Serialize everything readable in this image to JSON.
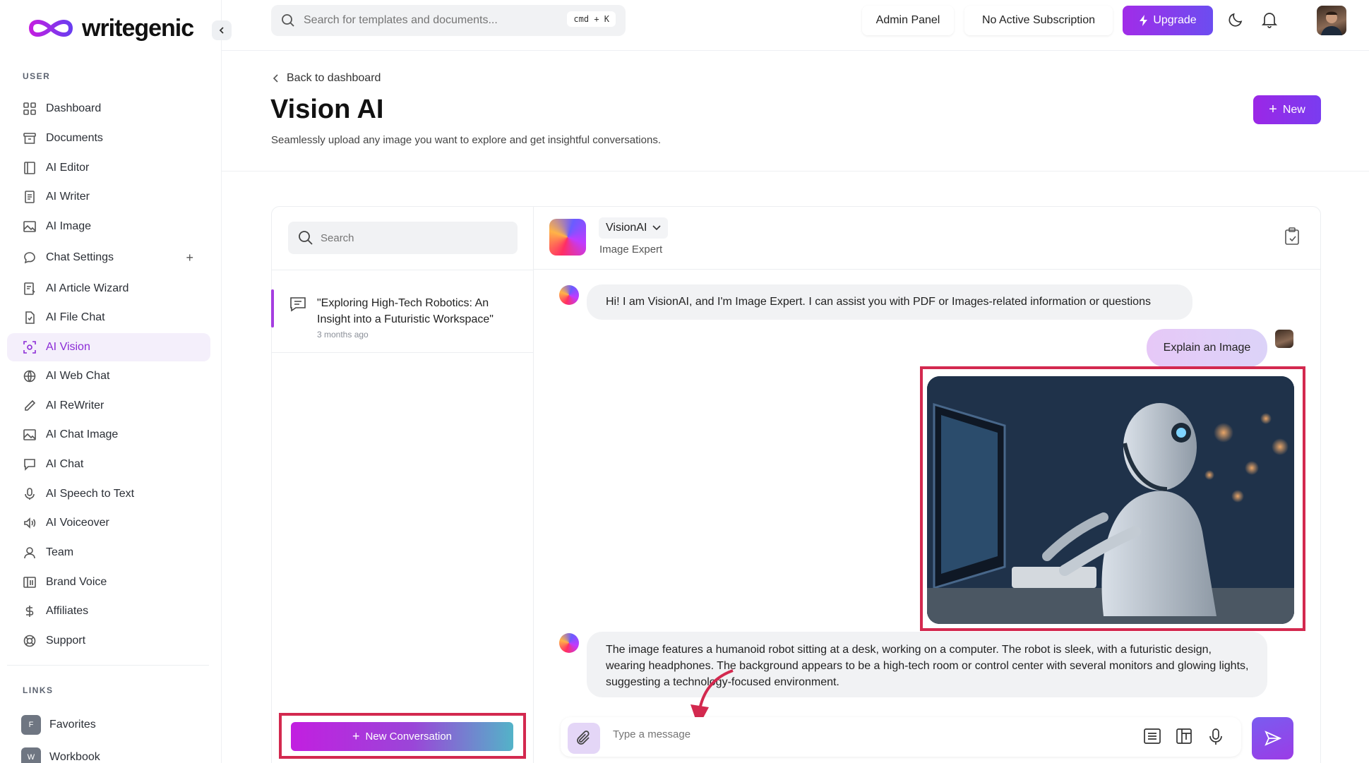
{
  "brand": {
    "name": "writegenic",
    "accent": "#8b2bd6"
  },
  "search": {
    "placeholder": "Search for templates and documents...",
    "shortcut": "cmd + K"
  },
  "topbar": {
    "admin_label": "Admin Panel",
    "subscription_label": "No Active Subscription",
    "upgrade_label": "Upgrade"
  },
  "sidebar": {
    "user_section": "USER",
    "items": [
      {
        "label": "Dashboard",
        "icon": "grid-icon"
      },
      {
        "label": "Documents",
        "icon": "archive-icon"
      },
      {
        "label": "AI Editor",
        "icon": "book-icon"
      },
      {
        "label": "AI Writer",
        "icon": "document-icon"
      },
      {
        "label": "AI Image",
        "icon": "image-icon"
      },
      {
        "label": "Chat Settings",
        "icon": "chat-bubble-icon"
      },
      {
        "label": "AI Article Wizard",
        "icon": "wizard-icon"
      },
      {
        "label": "AI File Chat",
        "icon": "file-icon"
      },
      {
        "label": "AI Vision",
        "icon": "vision-icon"
      },
      {
        "label": "AI Web Chat",
        "icon": "globe-icon"
      },
      {
        "label": "AI ReWriter",
        "icon": "pen-icon"
      },
      {
        "label": "AI Chat Image",
        "icon": "image-icon"
      },
      {
        "label": "AI Chat",
        "icon": "message-icon"
      },
      {
        "label": "AI Speech to Text",
        "icon": "microphone-icon"
      },
      {
        "label": "AI Voiceover",
        "icon": "speaker-icon"
      },
      {
        "label": "Team",
        "icon": "user-icon"
      },
      {
        "label": "Brand Voice",
        "icon": "brand-icon"
      },
      {
        "label": "Affiliates",
        "icon": "dollar-icon"
      },
      {
        "label": "Support",
        "icon": "lifebuoy-icon"
      }
    ],
    "links_section": "LINKS",
    "links": [
      {
        "badge": "F",
        "label": "Favorites"
      },
      {
        "badge": "W",
        "label": "Workbook"
      }
    ]
  },
  "page": {
    "back_label": "Back to dashboard",
    "title": "Vision AI",
    "subtitle": "Seamlessly upload any image you want to explore and get insightful conversations.",
    "new_label": "New"
  },
  "conversations": {
    "search_placeholder": "Search",
    "items": [
      {
        "title": "\"Exploring High-Tech Robotics: An Insight into a Futuristic Workspace\"",
        "time": "3 months ago"
      }
    ],
    "new_label": "New Conversation"
  },
  "chat": {
    "bot_name": "VisionAI",
    "bot_role": "Image Expert",
    "messages": {
      "greeting": "Hi! I am VisionAI, and I'm Image Expert. I can assist you with PDF or Images-related information or questions",
      "user_prompt": "Explain an Image",
      "reply": "The image features a humanoid robot sitting at a desk, working on a computer. The robot is sleek, with a futuristic design, wearing headphones. The background appears to be a high-tech room or control center with several monitors and glowing lights, suggesting a technology-focused environment."
    },
    "input_placeholder": "Type a message"
  }
}
